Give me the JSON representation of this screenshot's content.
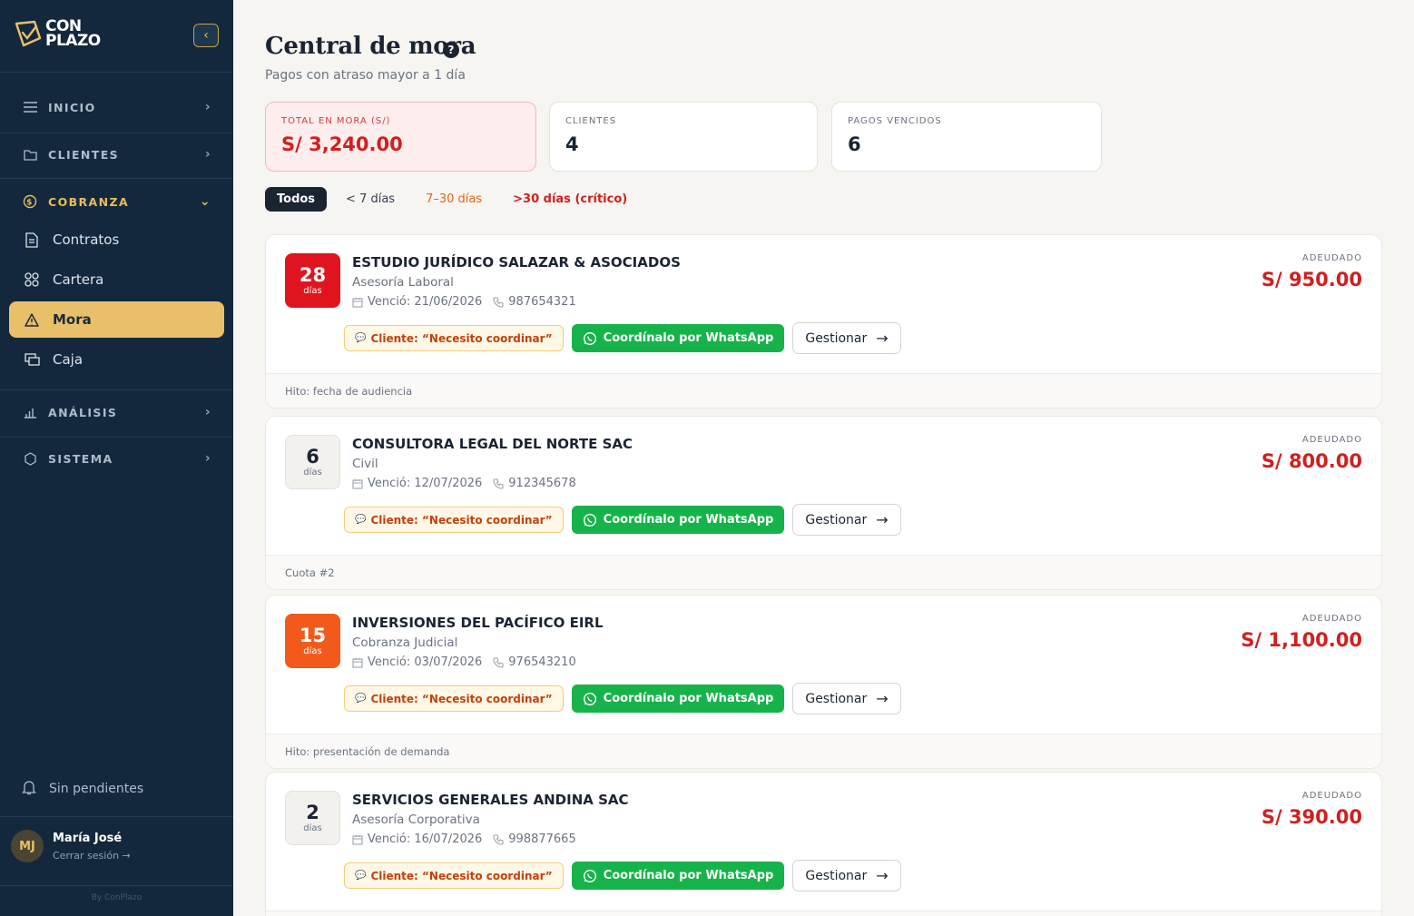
{
  "brand": {
    "line1": "CON",
    "line2": "PLAZO"
  },
  "sidebar": {
    "sections": {
      "inicio": "INICIO",
      "clientes": "CLIENTES",
      "cobranza": "COBRANZA",
      "analisis": "ANÁLISIS",
      "sistema": "SISTEMA"
    },
    "items": {
      "contratos": "Contratos",
      "cartera": "Cartera",
      "mora": "Mora",
      "caja": "Caja"
    },
    "notifications": "Sin pendientes",
    "user": {
      "initials": "MJ",
      "name": "María José",
      "logout": "Cerrar sesión →"
    },
    "byline": "By ConPlazo"
  },
  "page": {
    "title": "Central de mora",
    "subtitle": "Pagos con atraso mayor a 1 día"
  },
  "stats": [
    {
      "label": "TOTAL EN MORA (S/)",
      "value": "S/ 3,240.00"
    },
    {
      "label": "CLIENTES",
      "value": "4"
    },
    {
      "label": "PAGOS VENCIDOS",
      "value": "6"
    }
  ],
  "filters": [
    "Todos",
    "< 7 días",
    "7–30 días",
    ">30 días (crítico)"
  ],
  "labels": {
    "days_unit": "días",
    "owed": "ADEUDADO",
    "whatsapp": "Coordínalo por WhatsApp",
    "manage": "Gestionar"
  },
  "cards": [
    {
      "days": "28",
      "name": "ESTUDIO JURÍDICO SALAZAR & ASOCIADOS",
      "type": "Asesoría Laboral",
      "due": "Venció: 21/06/2026",
      "phone": "987654321",
      "note": "Cliente: “Necesito coordinar”",
      "owed": "S/ 950.00",
      "footer": "Hito: fecha de audiencia"
    },
    {
      "days": "6",
      "name": "CONSULTORA LEGAL DEL NORTE SAC",
      "type": "Civil",
      "due": "Venció: 12/07/2026",
      "phone": "912345678",
      "note": "Cliente: “Necesito coordinar”",
      "owed": "S/ 800.00",
      "footer": "Cuota #2"
    },
    {
      "days": "15",
      "name": "INVERSIONES DEL PACÍFICO EIRL",
      "type": "Cobranza Judicial",
      "due": "Venció: 03/07/2026",
      "phone": "976543210",
      "note": "Cliente: “Necesito coordinar”",
      "owed": "S/ 1,100.00",
      "footer": "Hito: presentación de demanda"
    },
    {
      "days": "2",
      "name": "SERVICIOS GENERALES ANDINA SAC",
      "type": "Asesoría Corporativa",
      "due": "Venció: 16/07/2026",
      "phone": "998877665",
      "note": "Cliente: “Necesito coordinar”",
      "owed": "S/ 390.00",
      "footer": ""
    }
  ],
  "colors": {
    "sidebar": "#14283d",
    "accent": "#e8c06a",
    "danger": "#d11f1f",
    "warning": "#f25a1c",
    "whatsapp": "#16b34a"
  }
}
